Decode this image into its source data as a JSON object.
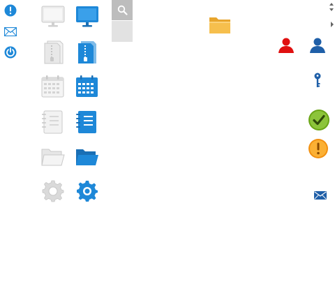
{
  "colors": {
    "accent_blue": "#1e88d8",
    "dark_blue": "#1f5fa8",
    "disabled_gray": "#d9d9d9",
    "disabled_stroke": "#c4c4c4",
    "folder_orange": "#f3b53c",
    "user_red": "#e01010",
    "ok_green": "#7bb31f",
    "warn_orange": "#f59a18"
  },
  "left_icons": [
    "alert-icon",
    "mail-icon",
    "power-icon"
  ],
  "sprite_pairs": [
    {
      "name": "monitor",
      "states": [
        "disabled",
        "active"
      ]
    },
    {
      "name": "zip-file",
      "states": [
        "disabled",
        "active"
      ]
    },
    {
      "name": "calendar",
      "states": [
        "disabled",
        "active"
      ]
    },
    {
      "name": "notebook",
      "states": [
        "disabled",
        "active"
      ]
    },
    {
      "name": "folder",
      "states": [
        "disabled",
        "active"
      ]
    },
    {
      "name": "gear",
      "states": [
        "disabled",
        "active"
      ]
    }
  ],
  "right_icons": [
    "sort-arrows-icon",
    "chevron-right-icon",
    "folder-icon",
    "user-red-icon",
    "user-blue-icon",
    "key-icon",
    "check-badge-icon",
    "warning-badge-icon",
    "mail-small-icon"
  ]
}
